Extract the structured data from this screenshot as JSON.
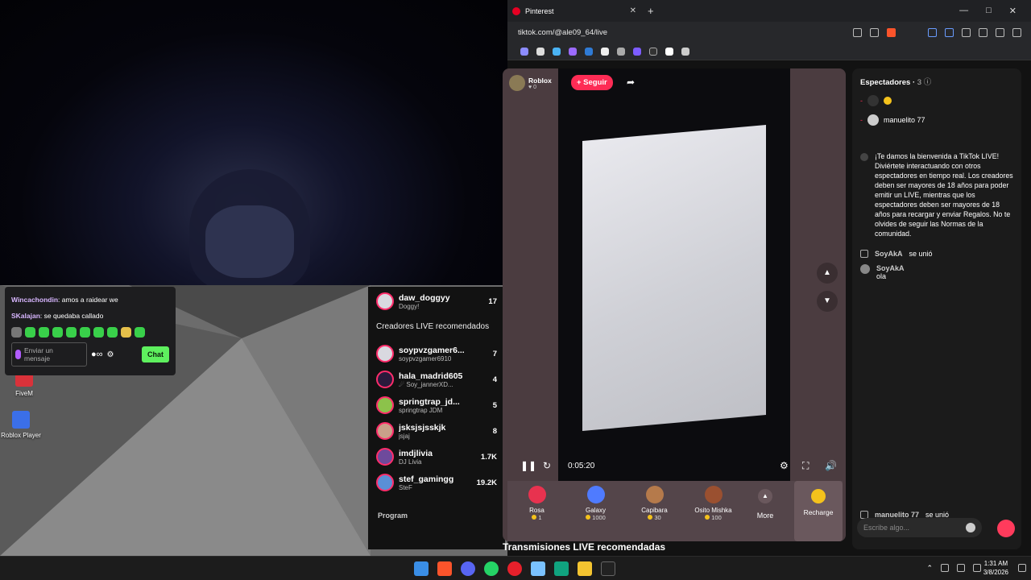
{
  "desktop": {
    "icons": [
      {
        "label": "FiveM",
        "icon": "fivem-icon"
      },
      {
        "label": "Roblox Player",
        "icon": "roblox-icon"
      }
    ]
  },
  "stream_chat": {
    "messages": [
      {
        "user": "Wincachondin",
        "text": "amos a raidear we"
      },
      {
        "user": "SKalajan",
        "text": "se quedaba callado"
      }
    ],
    "input_placeholder": "Enviar un mensaje",
    "send_label": "Chat"
  },
  "side_panel": {
    "top_item": {
      "name": "daw_doggyy",
      "sub": "Doggy!",
      "count": "17"
    },
    "section_title": "Creadores LIVE recomendados",
    "items": [
      {
        "name": "soypvzgamer6...",
        "sub": "soypvzgamer6910",
        "count": "7"
      },
      {
        "name": "hala_madrid605",
        "sub": "☄ Soy_jannerXD...",
        "count": "4"
      },
      {
        "name": "springtrap_jd...",
        "sub": "springtrap JDM",
        "count": "5"
      },
      {
        "name": "jsksjsjsskjk",
        "sub": "jsjaj",
        "count": "8"
      },
      {
        "name": "imdjlivia",
        "sub": "DJ Livia",
        "count": "1.7K"
      },
      {
        "name": "stef_gamingg",
        "sub": "SteF",
        "count": "19.2K"
      }
    ],
    "footer_label": "Program"
  },
  "browser": {
    "tab_title": "Pinterest",
    "url": "tiktok.com/@ale09_64/live",
    "live": {
      "host_name": "Roblox",
      "host_likes": "0",
      "follow_label": "+ Seguir",
      "timer": "0:05:20",
      "gifts": [
        {
          "name": "Rosa",
          "price": "1",
          "color": "#e8324f"
        },
        {
          "name": "Galaxy",
          "price": "1000",
          "color": "#4f7bff"
        },
        {
          "name": "Capibara",
          "price": "30",
          "color": "#b57a4b"
        },
        {
          "name": "Osito Mishka",
          "price": "100",
          "color": "#9a5030"
        }
      ],
      "more_label": "More",
      "recharge_label": "Recharge",
      "recommended_heading": "Transmisiones LIVE recomendadas"
    },
    "viewers_panel": {
      "title": "Espectadores",
      "count": "3",
      "viewers": [
        "manuelito 77"
      ],
      "welcome_text": "¡Te damos la bienvenida a TikTok LIVE! Diviértete interactuando con otros espectadores en tiempo real. Los creadores deben ser mayores de 18 años para poder emitir un LIVE, mientras que los espectadores deben ser mayores de 18 años para recargar y enviar Regalos. No te olvides de seguir las Normas de la comunidad.",
      "events": [
        {
          "user": "SoyAkA",
          "text": "se unió"
        }
      ],
      "comment": {
        "user": "SoyAkA",
        "text": "ola"
      },
      "bottom_event": {
        "user": "manuelito 77",
        "text": "se unió"
      },
      "input_placeholder": "Escribe algo..."
    }
  },
  "taskbar": {
    "time": "1:31 AM",
    "date": "3/8/2026"
  }
}
